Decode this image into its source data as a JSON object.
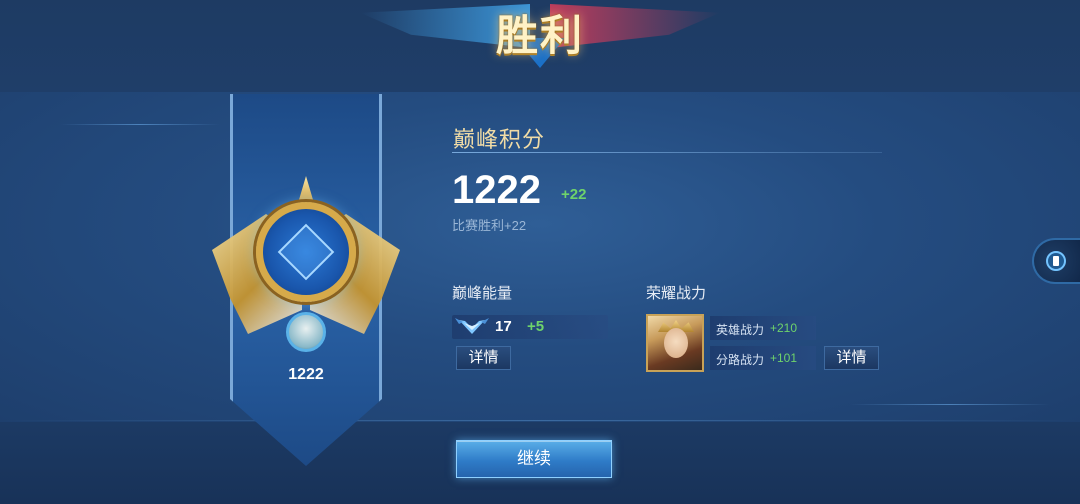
{
  "victory": {
    "title": "胜利"
  },
  "medal": {
    "score": "1222"
  },
  "peak": {
    "title": "巅峰积分",
    "score": "1222",
    "delta": "+22",
    "note": "比赛胜利+22"
  },
  "energy": {
    "label": "巅峰能量",
    "value": "17",
    "delta": "+5",
    "detail_label": "详情"
  },
  "glory": {
    "label": "荣耀战力",
    "rows": [
      {
        "label": "英雄战力",
        "value": "+210"
      },
      {
        "label": "分路战力",
        "value": "+101"
      }
    ],
    "detail_label": "详情"
  },
  "actions": {
    "continue_label": "继续"
  },
  "colors": {
    "accent_gold": "#f1dca6",
    "positive_green": "#6ed36b",
    "button_blue": "#2f7cc8"
  },
  "icons": [
    "energy-wings-icon",
    "hero-portrait",
    "side-menu-icon"
  ]
}
